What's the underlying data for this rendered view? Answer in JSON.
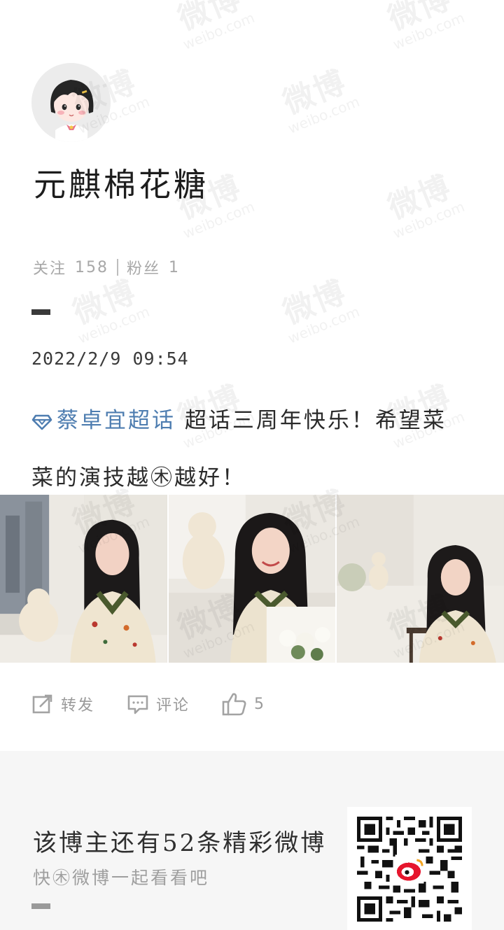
{
  "profile": {
    "username": "元麒棉花糖",
    "following_label": "关注",
    "following_count": "158",
    "followers_label": "粉丝",
    "followers_count": "1"
  },
  "post": {
    "timestamp": "2022/2/9 09:54",
    "topic": "蔡卓宜超话",
    "text_line1": "超话三周年快乐！希望菜",
    "text_line2": "菜的演技越㊍越好！",
    "photos": [
      "photo-1",
      "photo-2",
      "photo-3"
    ]
  },
  "actions": {
    "repost_label": "转发",
    "comment_label": "评论",
    "like_count": "5"
  },
  "footer": {
    "title": "该博主还有52条精彩微博",
    "subtitle": "快㊍微博一起看看吧"
  },
  "watermark": {
    "cn": "微博",
    "en": "weibo.com"
  },
  "colors": {
    "topic": "#4e7db0",
    "weibo_red": "#e6162d",
    "footer_bg": "#f6f6f6"
  }
}
